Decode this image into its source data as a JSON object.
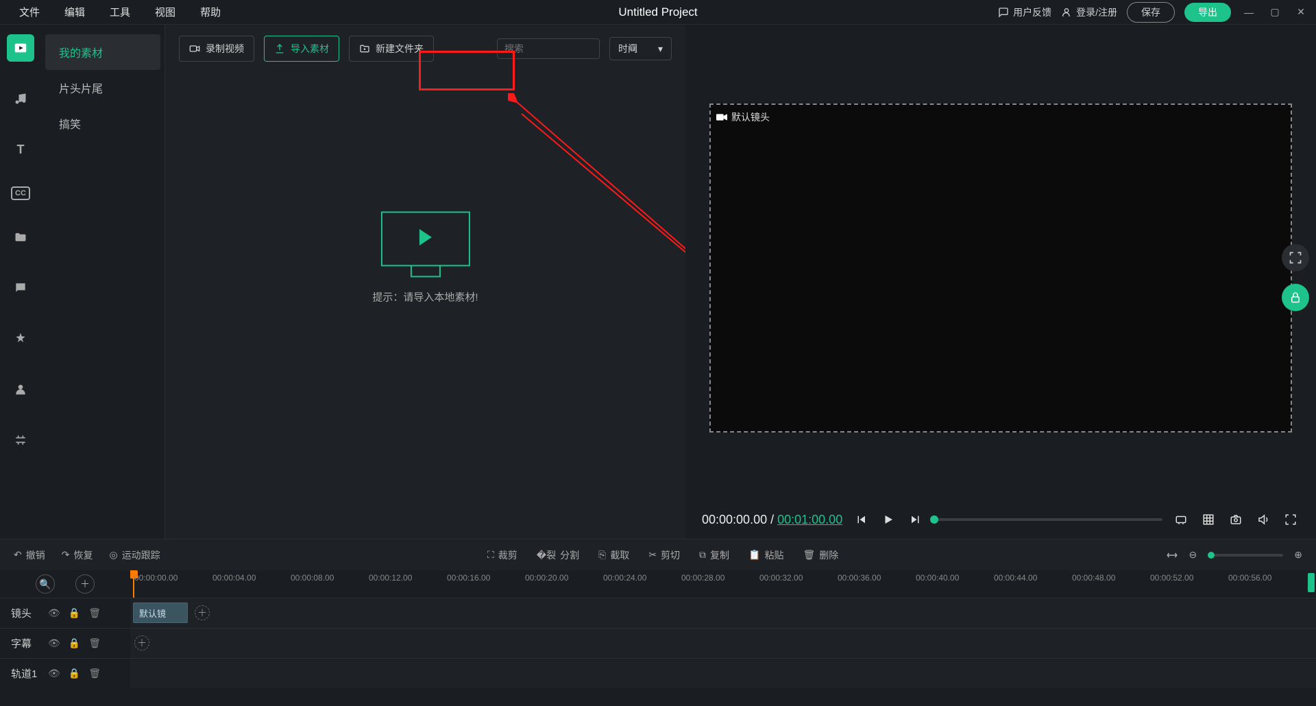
{
  "menu": {
    "file": "文件",
    "edit": "编辑",
    "tools": "工具",
    "view": "视图",
    "help": "帮助"
  },
  "title": "Untitled Project",
  "header": {
    "feedback": "用户反馈",
    "login": "登录/注册",
    "save": "保存",
    "export": "导出"
  },
  "categories": {
    "my_media": "我的素材",
    "intro_outro": "片头片尾",
    "funny": "搞笑"
  },
  "media_toolbar": {
    "record": "录制视频",
    "import": "导入素材",
    "new_folder": "新建文件夹",
    "search_placeholder": "搜索",
    "sort": "时间"
  },
  "empty_hint": "提示：请导入本地素材!",
  "preview": {
    "camera_label": "默认镜头",
    "current_time": "00:00:00.00",
    "sep": " / ",
    "duration": "00:01:00.00"
  },
  "tl_toolbar": {
    "undo": "撤销",
    "redo": "恢复",
    "motion_track": "运动跟踪",
    "crop": "裁剪",
    "split": "分割",
    "extract": "截取",
    "cut": "剪切",
    "copy": "复制",
    "paste": "粘贴",
    "delete": "删除"
  },
  "ruler": [
    "00:00:00.00",
    "00:00:04.00",
    "00:00:08.00",
    "00:00:12.00",
    "00:00:16.00",
    "00:00:20.00",
    "00:00:24.00",
    "00:00:28.00",
    "00:00:32.00",
    "00:00:36.00",
    "00:00:40.00",
    "00:00:44.00",
    "00:00:48.00",
    "00:00:52.00",
    "00:00:56.00"
  ],
  "tracks": {
    "camera": "镜头",
    "subtitle": "字幕",
    "track1": "轨道1",
    "default_clip": "默认镜"
  }
}
